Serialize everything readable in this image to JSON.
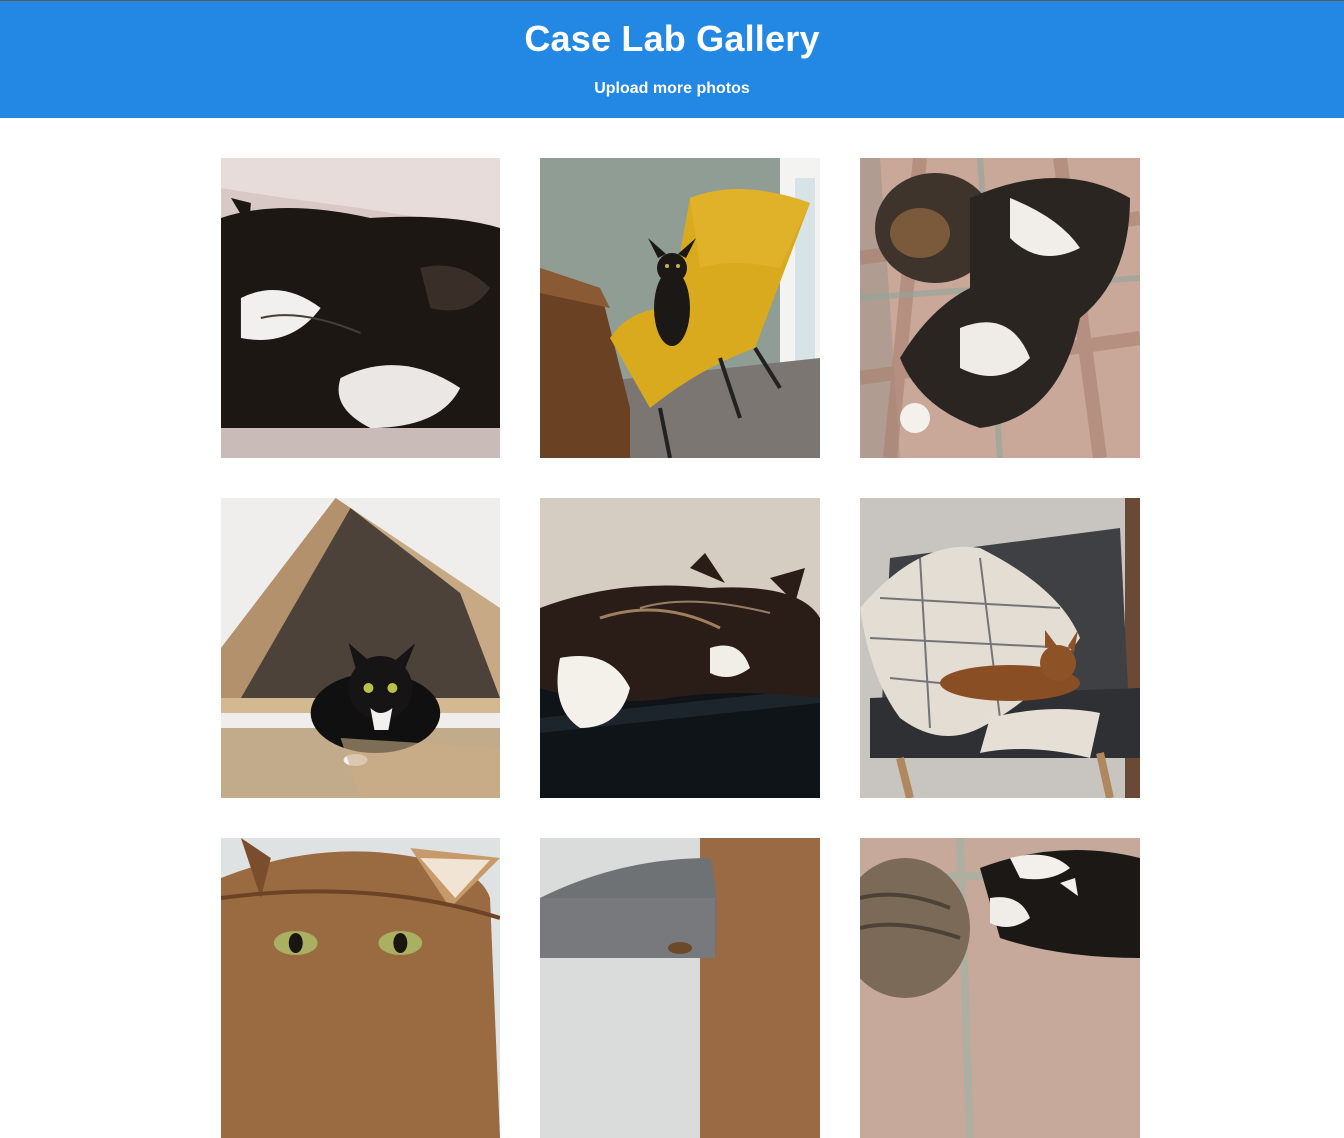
{
  "header": {
    "title": "Case Lab Gallery",
    "upload_link": "Upload more photos",
    "background_color": "#2288e4",
    "text_color": "#ffffff"
  },
  "gallery": {
    "photos": [
      {
        "subject": "fluffy black-and-white cat lying on pink fur rug"
      },
      {
        "subject": "black sphynx-like cat sitting on yellow chair"
      },
      {
        "subject": "tortoiseshell cat and black-and-white cat on plaid blanket"
      },
      {
        "subject": "black-and-white cat inside cardboard box"
      },
      {
        "subject": "black-and-white cat sleeping on dark shelf"
      },
      {
        "subject": "ginger cat resting on blanket in grey armchair"
      },
      {
        "subject": "ginger cat face close-up"
      },
      {
        "subject": "grey sofa with cat partially visible"
      },
      {
        "subject": "tabby and black-and-white cats on plaid blanket"
      }
    ]
  }
}
